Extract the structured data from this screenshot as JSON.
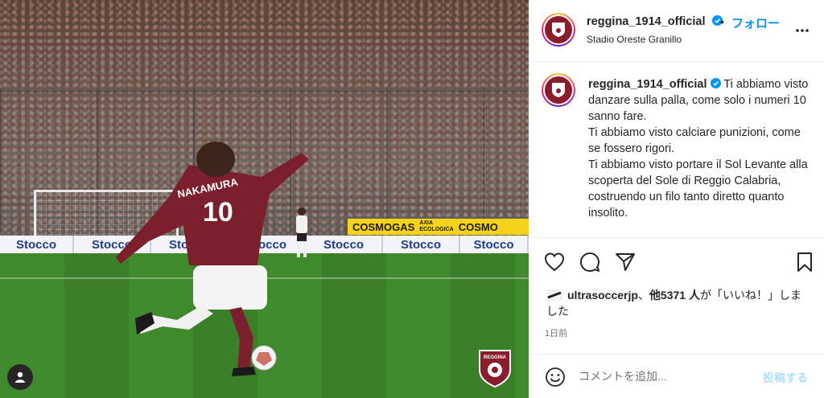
{
  "post": {
    "photo_ads": [
      "Stocco",
      "Stocco",
      "Stocco",
      "Stocco",
      "Stocco",
      "Stocco",
      "Stocco"
    ],
    "photo_yellow_ad": "COSMOGAS",
    "photo_yellow_ad_small_1": "AXIA",
    "photo_yellow_ad_small_2": "ECOLOGICA",
    "photo_yellow_ad_2": "COSMO",
    "jersey_name": "NAKAMURA",
    "jersey_number": "10",
    "crest_text": "REGGINA"
  },
  "header": {
    "username": "reggina_1914_official",
    "dot": "•",
    "follow_label": "フォロー",
    "location": "Stadio Oreste Granillo"
  },
  "caption": {
    "username": "reggina_1914_official",
    "text": "Ti abbiamo visto danzare sulla palla, come solo i numeri 10 sanno fare.\nTi abbiamo visto calciare punizioni, come se fossero rigori.\nTi abbiamo visto portare il Sol Levante alla scoperta del Sole di Reggio Calabria, costruendo un filo tanto diretto quanto insolito."
  },
  "likes": {
    "user": "ultrasoccerjp",
    "sep": "、",
    "count": "他5371 人",
    "suffix": "が「いいね！」しました"
  },
  "time": "1日前",
  "comment": {
    "placeholder": "コメントを追加...",
    "post_label": "投稿する"
  },
  "colors": {
    "accent": "#0095f6",
    "post_disabled": "#b2dffc",
    "club": "#8a1d2c"
  },
  "icons": [
    "heart-icon",
    "comment-icon",
    "share-icon",
    "bookmark-icon",
    "more-icon",
    "emoji-icon",
    "user-tag-icon",
    "verified-icon"
  ]
}
